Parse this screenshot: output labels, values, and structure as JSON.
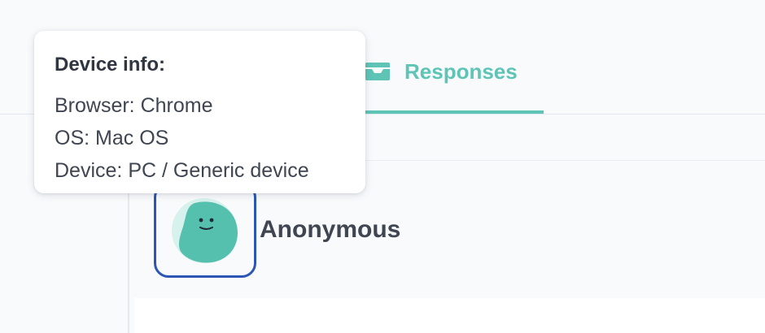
{
  "tabs": {
    "responses": {
      "label": "Responses",
      "icon": "inbox-tray-icon",
      "active": true
    }
  },
  "respondent": {
    "name": "Anonymous",
    "avatar": "smiley-face-avatar-icon"
  },
  "device_tooltip": {
    "title": "Device info:",
    "browser": {
      "label": "Browser:",
      "value": "Chrome"
    },
    "os": {
      "label": "OS:",
      "value": "Mac OS"
    },
    "device": {
      "label": "Device:",
      "value": "PC / Generic device"
    }
  },
  "colors": {
    "accent": "#5ec4b6",
    "selection_outline": "#2c56b5",
    "avatar_fill": "#56c0ae",
    "avatar_light": "#d7f1ec",
    "text_dark": "#3f4551"
  }
}
